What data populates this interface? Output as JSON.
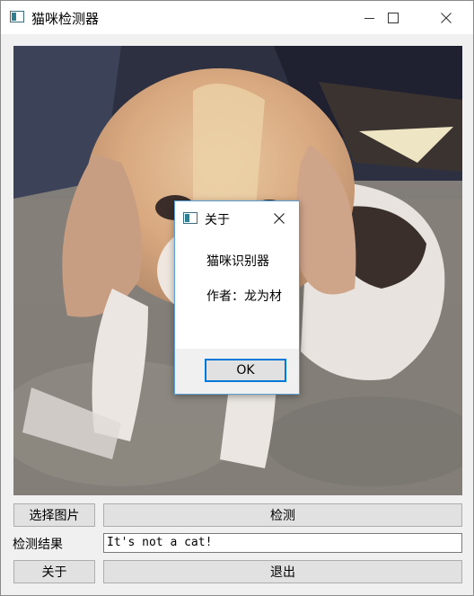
{
  "window": {
    "title": "猫咪检测器",
    "controls": {
      "minimize": "minimize-icon",
      "maximize": "maximize-icon",
      "close": "close-icon"
    }
  },
  "image": {
    "description_icon": "photo-of-dog"
  },
  "buttons": {
    "select_image": "选择图片",
    "detect": "检测",
    "about": "关于",
    "exit": "退出"
  },
  "result": {
    "label": "检测结果",
    "value": "It's not a cat!"
  },
  "about_dialog": {
    "title": "关于",
    "line1": "猫咪识别器",
    "line2": "作者：龙为材",
    "ok": "OK"
  },
  "colors": {
    "accent": "#0078d7",
    "button_bg": "#e1e1e1",
    "window_bg": "#f0f0f0"
  }
}
